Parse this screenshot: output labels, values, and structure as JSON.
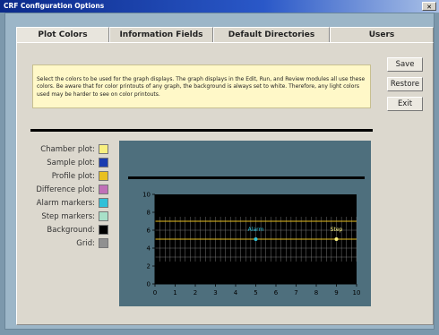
{
  "window": {
    "title": "CRF Configuration Options",
    "close_glyph": "✕"
  },
  "tabs": [
    {
      "label": "Plot Colors",
      "active": true
    },
    {
      "label": "Information Fields"
    },
    {
      "label": "Default Directories"
    },
    {
      "label": "Users"
    }
  ],
  "notice_text": "Select the colors to be used for the graph displays.  The graph displays in the Edit, Run, and Review modules all use these colors.  Be aware that for color printouts of any graph, the background is always set to white. Therefore, any light colors used may be harder to see on color printouts.",
  "buttons": {
    "save": "Save",
    "restore": "Restore",
    "exit": "Exit"
  },
  "color_settings": [
    {
      "label": "Chamber plot:",
      "color": "#f8f080"
    },
    {
      "label": "Sample plot:",
      "color": "#1a3cb0"
    },
    {
      "label": "Profile plot:",
      "color": "#e8c020"
    },
    {
      "label": "Difference plot:",
      "color": "#c070b8"
    },
    {
      "label": "Alarm markers:",
      "color": "#30c0d8"
    },
    {
      "label": "Step markers:",
      "color": "#a8e0c8"
    },
    {
      "label": "Background:",
      "color": "#000000"
    },
    {
      "label": "Grid:",
      "color": "#909090"
    }
  ],
  "chart_data": {
    "type": "line",
    "x_ticks": [
      "0",
      "1",
      "2",
      "3",
      "4",
      "5",
      "6",
      "7",
      "8",
      "9",
      "10"
    ],
    "y_ticks": [
      "0",
      "2",
      "4",
      "6",
      "8",
      "10"
    ],
    "xlim": [
      0,
      10
    ],
    "ylim": [
      0,
      10
    ],
    "series": [
      {
        "x": [
          0,
          10
        ],
        "y": [
          7,
          7
        ],
        "color": "#e8c020"
      },
      {
        "x": [
          0,
          10
        ],
        "y": [
          5,
          5
        ],
        "color": "#e8c020"
      }
    ],
    "markers": [
      {
        "label": "Alarm",
        "x": 5,
        "y": 5,
        "color": "#30c0d8"
      },
      {
        "label": "Step",
        "x": 9,
        "y": 5,
        "color": "#f8f080"
      }
    ],
    "grid": true,
    "background": "#000000"
  }
}
